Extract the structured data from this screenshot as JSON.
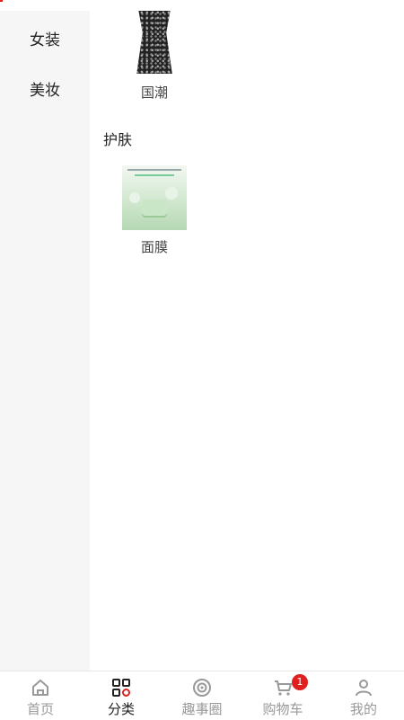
{
  "sidebar": {
    "items": [
      {
        "label": "女装"
      },
      {
        "label": "美妆"
      }
    ]
  },
  "products": {
    "top_item": {
      "label": "国潮"
    },
    "section": {
      "title": "护肤"
    },
    "section_item": {
      "label": "面膜"
    }
  },
  "tabbar": {
    "tabs": [
      {
        "label": "首页",
        "icon": "home-icon"
      },
      {
        "label": "分类",
        "icon": "grid-icon"
      },
      {
        "label": "趣事圈",
        "icon": "circle-icon"
      },
      {
        "label": "购物车",
        "icon": "cart-icon",
        "badge": "1"
      },
      {
        "label": "我的",
        "icon": "user-icon"
      }
    ],
    "active_index": 1,
    "active_color": "#222222",
    "inactive_color": "#999999",
    "badge_color": "#e0201e"
  }
}
